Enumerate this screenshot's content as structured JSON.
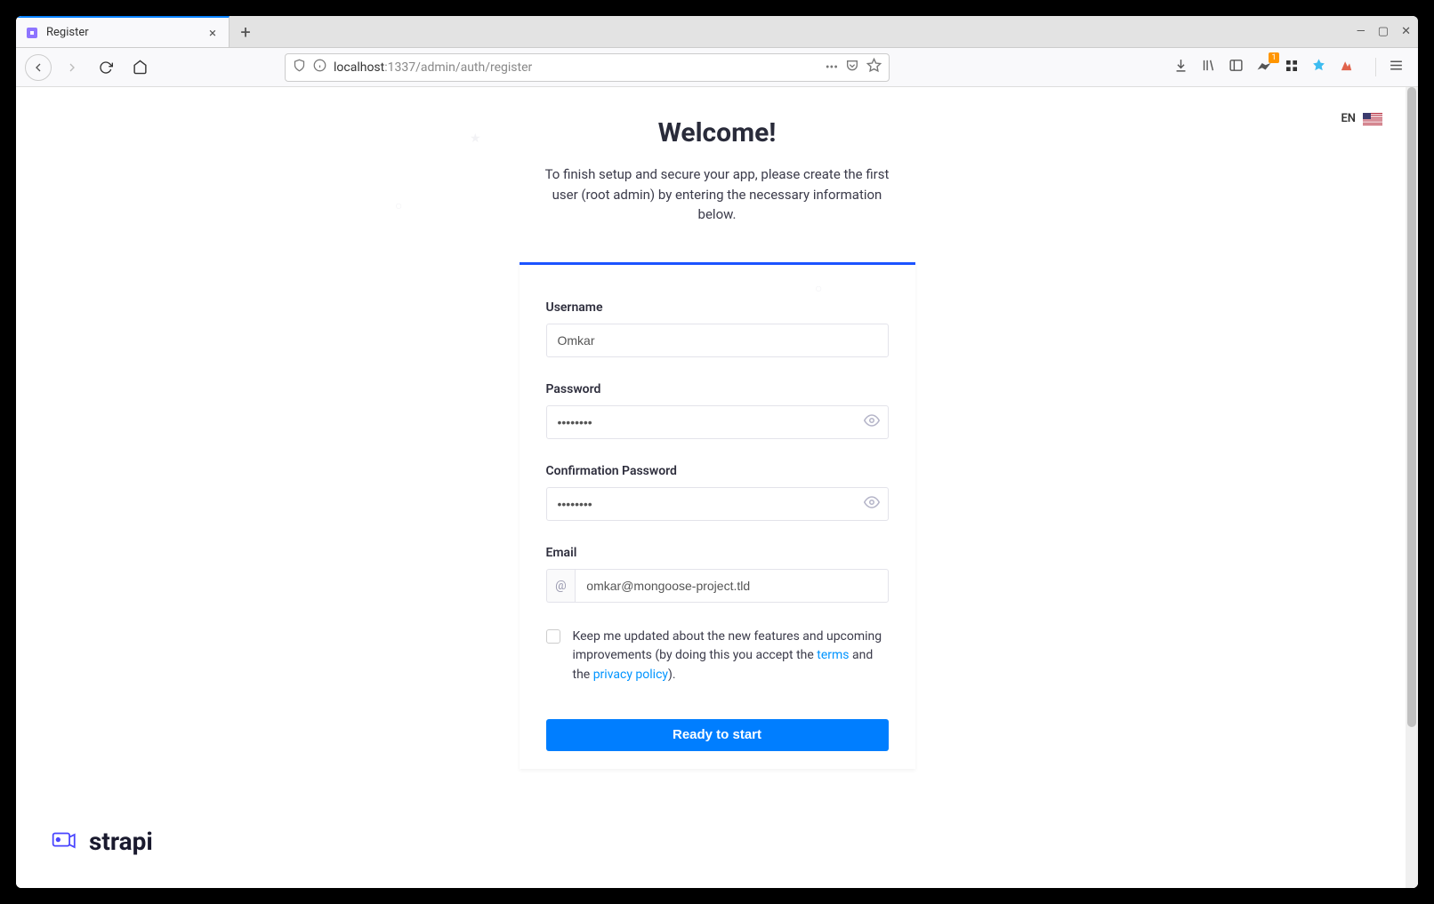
{
  "browser": {
    "tab_title": "Register",
    "url_host": "localhost",
    "url_rest": ":1337/admin/auth/register",
    "toolbar_badge": "1"
  },
  "lang": {
    "code": "EN"
  },
  "header": {
    "title": "Welcome!",
    "subtitle": "To finish setup and secure your app, please create the first user (root admin) by entering the necessary information below."
  },
  "form": {
    "username_label": "Username",
    "username_value": "Omkar",
    "password_label": "Password",
    "password_value": "••••••••",
    "confirm_label": "Confirmation Password",
    "confirm_value": "••••••••",
    "email_label": "Email",
    "email_prefix": "@",
    "email_value": "omkar@mongoose-project.tld",
    "newsletter_pre": "Keep me updated about the new features and upcoming improvements (by doing this you accept the ",
    "terms_link": "terms",
    "newsletter_mid": " and the ",
    "privacy_link": "privacy policy",
    "newsletter_post": ").",
    "submit": "Ready to start"
  },
  "footer": {
    "brand": "strapi"
  }
}
